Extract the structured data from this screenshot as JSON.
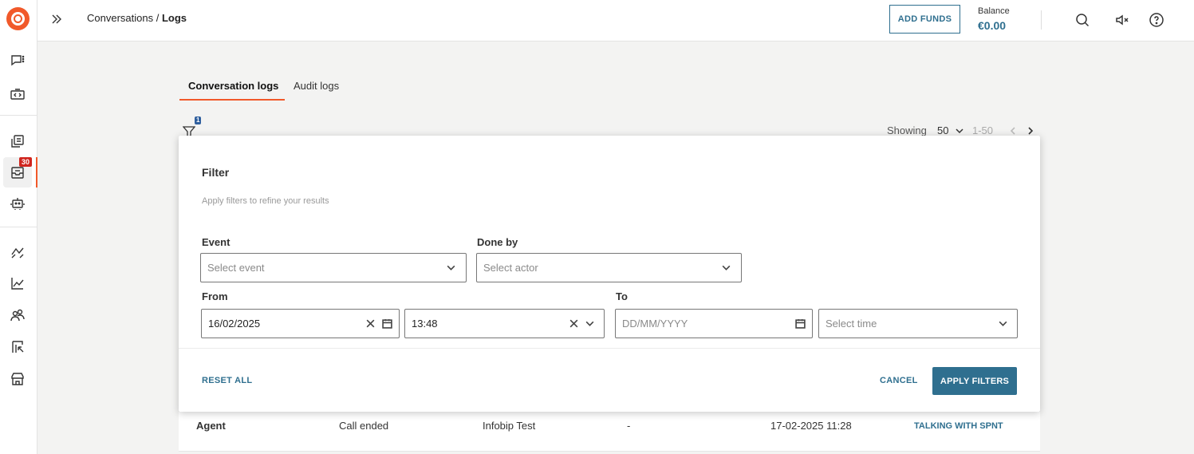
{
  "header": {
    "breadcrumb_parent": "Conversations / ",
    "breadcrumb_current": "Logs",
    "add_funds_label": "ADD FUNDS",
    "balance_label": "Balance",
    "balance_value": "€0.00"
  },
  "sidebar": {
    "badge_count": "30",
    "items": [
      {
        "icon": "chat-icon"
      },
      {
        "icon": "code-icon"
      },
      {
        "icon": "copy-chat-icon"
      },
      {
        "icon": "inbox-icon",
        "active": true
      },
      {
        "icon": "bot-icon"
      },
      {
        "icon": "flow-icon"
      },
      {
        "icon": "analytics-icon"
      },
      {
        "icon": "people-icon"
      },
      {
        "icon": "board-icon"
      },
      {
        "icon": "store-icon"
      }
    ]
  },
  "tabs": [
    {
      "label": "Conversation logs",
      "active": true
    },
    {
      "label": "Audit logs",
      "active": false
    }
  ],
  "toolbar": {
    "filter_count": "1",
    "showing_label": "Showing",
    "page_size": "50",
    "range": "1-50"
  },
  "filter": {
    "title": "Filter",
    "subtitle": "Apply filters to refine your results",
    "event_label": "Event",
    "event_placeholder": "Select event",
    "done_by_label": "Done by",
    "done_by_placeholder": "Select actor",
    "from_label": "From",
    "from_date": "16/02/2025",
    "from_time": "13:48",
    "to_label": "To",
    "to_date_placeholder": "DD/MM/YYYY",
    "to_time_placeholder": "Select time",
    "reset_label": "RESET ALL",
    "cancel_label": "CANCEL",
    "apply_label": "APPLY FILTERS"
  },
  "table": {
    "rows": [
      {
        "role": "Agent",
        "event": "Call ended",
        "actor": "Infobip Test",
        "detail": "-",
        "time": "17-02-2025 11:28",
        "status": "TALKING WITH SPNT"
      }
    ]
  },
  "colors": {
    "accent": "#f1592a",
    "primary": "#2f6f8f",
    "badge": "#d0261f"
  }
}
